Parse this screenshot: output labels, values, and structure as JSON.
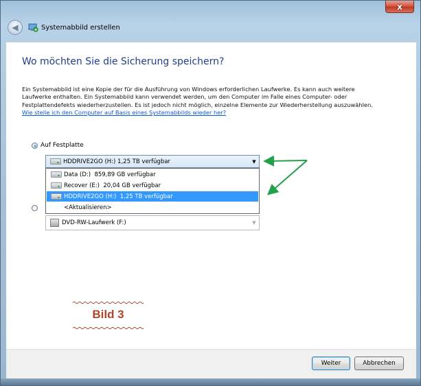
{
  "window": {
    "title": "Systemabbild erstellen",
    "close_label": "x"
  },
  "heading": "Wo möchten Sie die Sicherung speichern?",
  "intro": {
    "text": "Ein Systemabbild ist eine Kopie der für die Ausführung von Windows erforderlichen Laufwerke. Es kann auch weitere Laufwerke enthalten. Ein Systemabbild kann verwendet werden, um den Computer im Falle eines Computer- oder Festplattendefekts wiederherzustellen. Es ist jedoch nicht möglich, einzelne Elemente zur Wiederherstellung auszuwählen. ",
    "link": "Wie stelle ich den Computer auf Basis eines Systemabbilds wieder her?"
  },
  "options": {
    "harddisk": {
      "label": "Auf Festplatte",
      "checked": true,
      "selected_value": "HDDRIVE2GO (H:)  1,25 TB verfügbar",
      "dropdown_items": [
        {
          "label": "Data (D:)  859,89 GB verfügbar",
          "icon": "drive-icon",
          "selected": false
        },
        {
          "label": "Recover (E:)  20,04 GB verfügbar",
          "icon": "drive-icon",
          "selected": false
        },
        {
          "label": "HDDRIVE2GO (H:)  1,25 TB verfügbar",
          "icon": "drive-icon",
          "selected": true
        },
        {
          "label": "<Aktualisieren>",
          "icon": "",
          "selected": false
        }
      ]
    },
    "dvd": {
      "checked": false,
      "selected_value": "DVD-RW-Laufwerk (F:)"
    }
  },
  "annotation": {
    "caption": "Bild 3",
    "arrow_color": "#21a04a",
    "caption_color": "#b0442b"
  },
  "buttons": {
    "next": "Weiter",
    "cancel": "Abbrechen"
  },
  "colors": {
    "heading": "#1e3f8a",
    "link": "#0a5ad0",
    "selection": "#3399ff"
  }
}
